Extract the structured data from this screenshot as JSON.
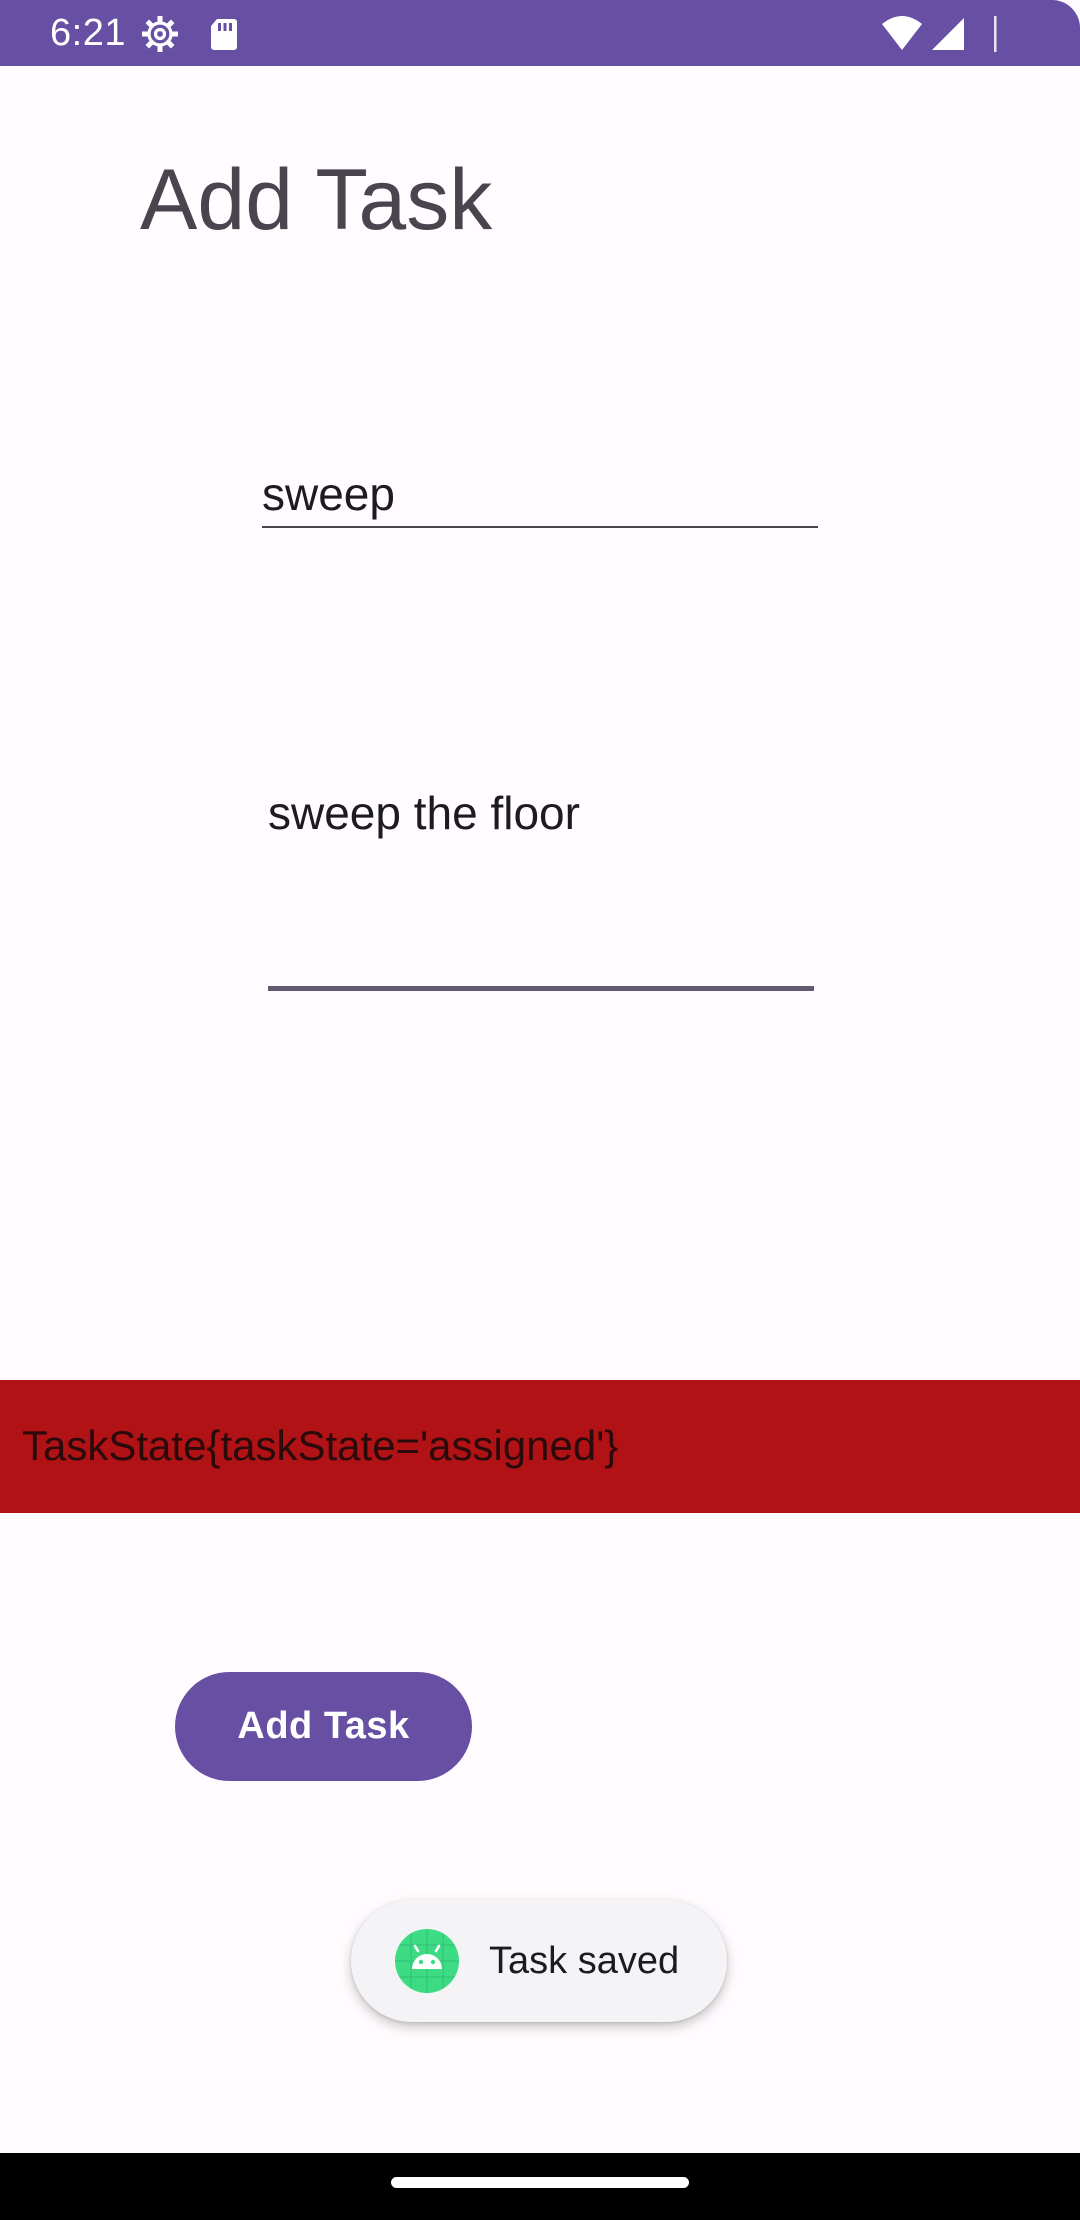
{
  "status_bar": {
    "time": "6:21",
    "icons": [
      "settings-gear-icon",
      "sd-card-icon",
      "wifi-icon",
      "cellular-signal-icon",
      "battery-icon"
    ],
    "background_color": "#6750A4"
  },
  "screen": {
    "title": "Add Task"
  },
  "form": {
    "task_name_value": "sweep",
    "task_description_value": "sweep the floor"
  },
  "task_state": {
    "text": "TaskState{taskState='assigned'}",
    "background_color": "#B01216"
  },
  "actions": {
    "add_task_label": "Add Task",
    "button_color": "#6750A4"
  },
  "toast": {
    "icon": "android-app-icon",
    "message": "Task saved"
  },
  "navigation": {
    "home_indicator": "home-indicator"
  }
}
